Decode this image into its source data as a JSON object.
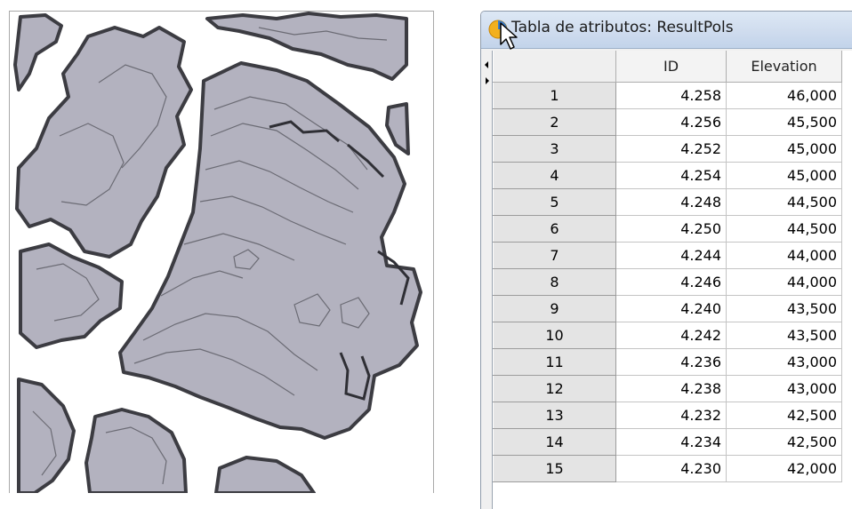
{
  "window": {
    "title": "Tabla de atributos: ResultPols",
    "icon": "arcgis-globe-icon"
  },
  "table": {
    "columns": [
      "",
      "ID",
      "Elevation"
    ],
    "rows": [
      {
        "n": "1",
        "id": "4.258",
        "elevation": "46,000"
      },
      {
        "n": "2",
        "id": "4.256",
        "elevation": "45,500"
      },
      {
        "n": "3",
        "id": "4.252",
        "elevation": "45,000"
      },
      {
        "n": "4",
        "id": "4.254",
        "elevation": "45,000"
      },
      {
        "n": "5",
        "id": "4.248",
        "elevation": "44,500"
      },
      {
        "n": "6",
        "id": "4.250",
        "elevation": "44,500"
      },
      {
        "n": "7",
        "id": "4.244",
        "elevation": "44,000"
      },
      {
        "n": "8",
        "id": "4.246",
        "elevation": "44,000"
      },
      {
        "n": "9",
        "id": "4.240",
        "elevation": "43,500"
      },
      {
        "n": "10",
        "id": "4.242",
        "elevation": "43,500"
      },
      {
        "n": "11",
        "id": "4.236",
        "elevation": "43,000"
      },
      {
        "n": "12",
        "id": "4.238",
        "elevation": "43,000"
      },
      {
        "n": "13",
        "id": "4.232",
        "elevation": "42,500"
      },
      {
        "n": "14",
        "id": "4.234",
        "elevation": "42,500"
      },
      {
        "n": "15",
        "id": "4.230",
        "elevation": "42,000"
      }
    ]
  },
  "colors": {
    "polygon_fill": "#b3b2bf",
    "polygon_edge": "#3c3c42",
    "contour_line": "#6b6b74",
    "row_header": "#e4e4e4"
  }
}
